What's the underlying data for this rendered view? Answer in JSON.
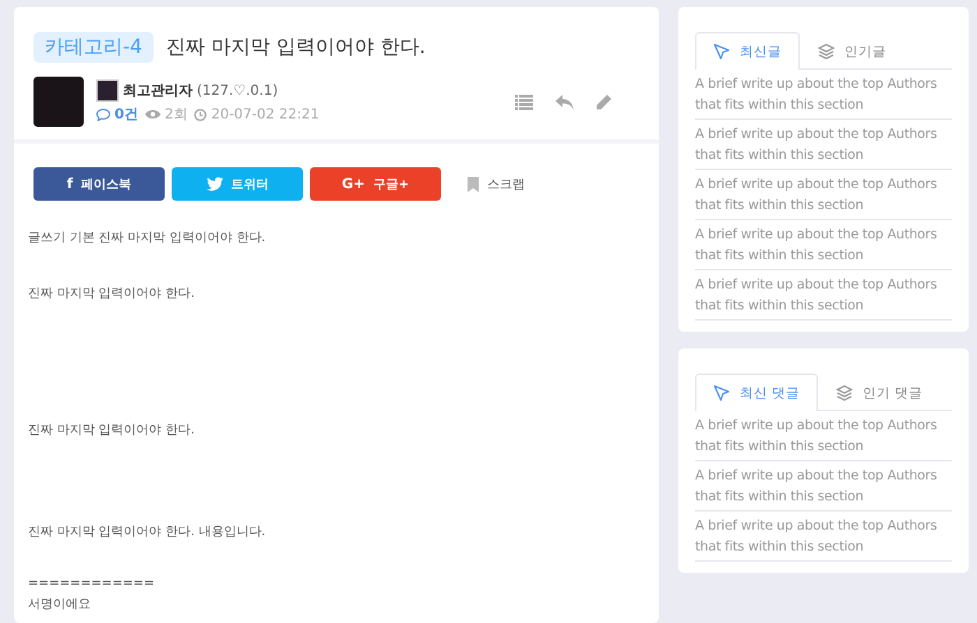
{
  "post": {
    "category": "카테고리-4",
    "title": "진짜 마지막 입력이어야 한다.",
    "author": {
      "name": "최고관리자",
      "ip": "(127.♡.0.1)"
    },
    "comments": "0건",
    "views": "2회",
    "date": "20-07-02 22:21",
    "share": [
      {
        "kind": "facebook",
        "glyph": "f",
        "label": "페이스북"
      },
      {
        "kind": "twitter",
        "label": "트위터"
      },
      {
        "kind": "google",
        "glyph": "G+",
        "label": "구글+"
      },
      {
        "kind": "scrap",
        "label": "스크랩"
      }
    ],
    "body": [
      "글쓰기 기본 진짜 마지막 입력이어야 한다.",
      "진짜 마지막 입력이어야 한다.",
      "진짜 마지막 입력이어야 한다.",
      "진짜 마지막 입력이어야 한다. 내용입니다.",
      "============",
      "서명이에요"
    ]
  },
  "sidebar": [
    {
      "tabs": [
        {
          "label": "최신글",
          "selected": true
        },
        {
          "label": "인기글",
          "selected": false
        }
      ],
      "items": [
        "A brief write up about the top Authors that fits within this section",
        "A brief write up about the top Authors that fits within this section",
        "A brief write up about the top Authors that fits within this section",
        "A brief write up about the top Authors that fits within this section",
        "A brief write up about the top Authors that fits within this section"
      ]
    },
    {
      "tabs": [
        {
          "label": "최신 댓글",
          "selected": true
        },
        {
          "label": "인기 댓글",
          "selected": false
        }
      ],
      "items": [
        "A brief write up about the top Authors that fits within this section",
        "A brief write up about the top Authors that fits within this section",
        "A brief write up about the top Authors that fits within this section"
      ]
    }
  ]
}
